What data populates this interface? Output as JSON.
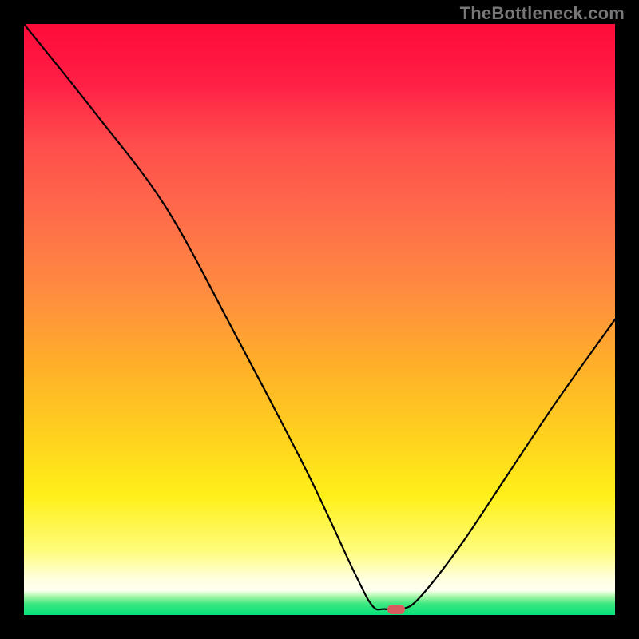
{
  "watermark": "TheBottleneck.com",
  "colors": {
    "black": "#000000",
    "curve": "#000000",
    "marker": "#d95b5f",
    "gradient_stops_main": [
      "#ff0b3a",
      "#ff1f45",
      "#ff4c4c",
      "#ff6b4a",
      "#ff8b40",
      "#ffb029",
      "#ffd21e",
      "#fff01a",
      "#fffc7a",
      "#ffffe0",
      "#fffff2"
    ],
    "gradient_stops_green": [
      "#fffff2",
      "#d9ffd0",
      "#9cf5a3",
      "#3de880",
      "#05e27b"
    ]
  },
  "chart_data": {
    "type": "line",
    "title": "",
    "xlabel": "",
    "ylabel": "",
    "xlim": [
      0,
      100
    ],
    "ylim": [
      0,
      100
    ],
    "grid": false,
    "legend": false,
    "curve_points": [
      {
        "x": 0,
        "y": 100
      },
      {
        "x": 12,
        "y": 85
      },
      {
        "x": 24,
        "y": 69
      },
      {
        "x": 36,
        "y": 47
      },
      {
        "x": 48,
        "y": 24
      },
      {
        "x": 56,
        "y": 7
      },
      {
        "x": 59,
        "y": 1.5
      },
      {
        "x": 61,
        "y": 1
      },
      {
        "x": 64,
        "y": 1
      },
      {
        "x": 67,
        "y": 3
      },
      {
        "x": 74,
        "y": 12
      },
      {
        "x": 82,
        "y": 24
      },
      {
        "x": 90,
        "y": 36
      },
      {
        "x": 100,
        "y": 50
      }
    ],
    "marker": {
      "x": 63,
      "y": 1
    },
    "background_gradient": {
      "direction": "top_to_bottom",
      "stops": [
        {
          "pos": 0.0,
          "color": "#ff0b3a"
        },
        {
          "pos": 0.1,
          "color": "#ff1f45"
        },
        {
          "pos": 0.2,
          "color": "#ff4c4c"
        },
        {
          "pos": 0.32,
          "color": "#ff6b4a"
        },
        {
          "pos": 0.45,
          "color": "#ff8b40"
        },
        {
          "pos": 0.58,
          "color": "#ffb029"
        },
        {
          "pos": 0.7,
          "color": "#ffd21e"
        },
        {
          "pos": 0.8,
          "color": "#fff01a"
        },
        {
          "pos": 0.89,
          "color": "#fffc7a"
        },
        {
          "pos": 0.94,
          "color": "#ffffe0"
        },
        {
          "pos": 0.958,
          "color": "#fffff2"
        },
        {
          "pos": 0.965,
          "color": "#d9ffd0"
        },
        {
          "pos": 0.975,
          "color": "#9cf5a3"
        },
        {
          "pos": 0.987,
          "color": "#3de880"
        },
        {
          "pos": 1.0,
          "color": "#05e27b"
        }
      ]
    }
  }
}
